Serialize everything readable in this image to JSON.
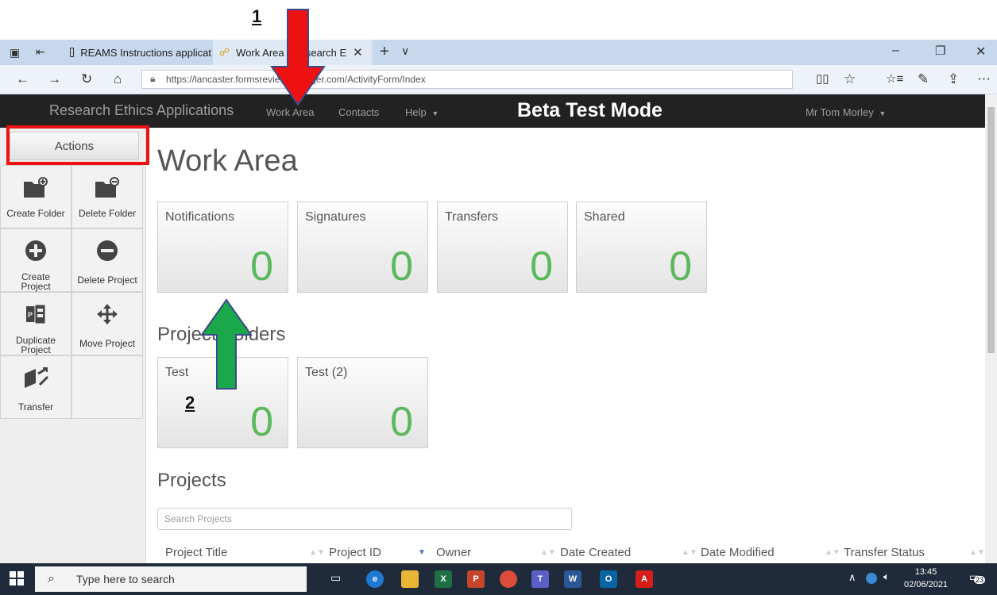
{
  "annotations": {
    "label_1": "1",
    "label_2": "2"
  },
  "browser": {
    "tabs": [
      {
        "label": "REAMS Instructions applicat",
        "active": false
      },
      {
        "label": "Work Area | Research E",
        "active": true
      }
    ],
    "url": "https://lancaster.formsreviewmanager.com/ActivityForm/Index",
    "nav_icons": [
      "back-icon",
      "forward-icon",
      "refresh-icon",
      "home-icon"
    ]
  },
  "navbar": {
    "brand": "Research Ethics Applications",
    "links": [
      "Work Area",
      "Contacts",
      "Help"
    ],
    "beta": "Beta Test Mode",
    "user": "Mr Tom Morley"
  },
  "sidebar": {
    "actions_label": "Actions",
    "items": [
      {
        "label": "Create Folder",
        "icon": "folder-add-icon"
      },
      {
        "label": "Delete Folder",
        "icon": "folder-remove-icon"
      },
      {
        "label": "Create Project",
        "icon": "plus-circle-icon"
      },
      {
        "label": "Delete Project",
        "icon": "minus-circle-icon"
      },
      {
        "label": "Duplicate Project",
        "icon": "duplicate-icon"
      },
      {
        "label": "Move Project",
        "icon": "move-icon"
      },
      {
        "label": "Transfer",
        "icon": "transfer-icon"
      }
    ]
  },
  "main": {
    "title": "Work Area",
    "tiles": [
      {
        "label": "Notifications",
        "count": "0"
      },
      {
        "label": "Signatures",
        "count": "0"
      },
      {
        "label": "Transfers",
        "count": "0"
      },
      {
        "label": "Shared",
        "count": "0"
      }
    ],
    "folders_title": "Project Folders",
    "folders": [
      {
        "label": "Test",
        "count": "0"
      },
      {
        "label": "Test (2)",
        "count": "0"
      }
    ],
    "projects_title": "Projects",
    "search_placeholder": "Search Projects",
    "columns": [
      "Project Title",
      "Project ID",
      "Owner",
      "Date Created",
      "Date Modified",
      "Transfer Status"
    ]
  },
  "taskbar": {
    "search_placeholder": "Type here to search",
    "time": "13:45",
    "date": "02/06/2021",
    "notifications": "23"
  },
  "colors": {
    "navbar": "#222222",
    "count_green": "#5cb85c",
    "arrow_red": "#ee1111",
    "arrow_green": "#1aa84a"
  }
}
